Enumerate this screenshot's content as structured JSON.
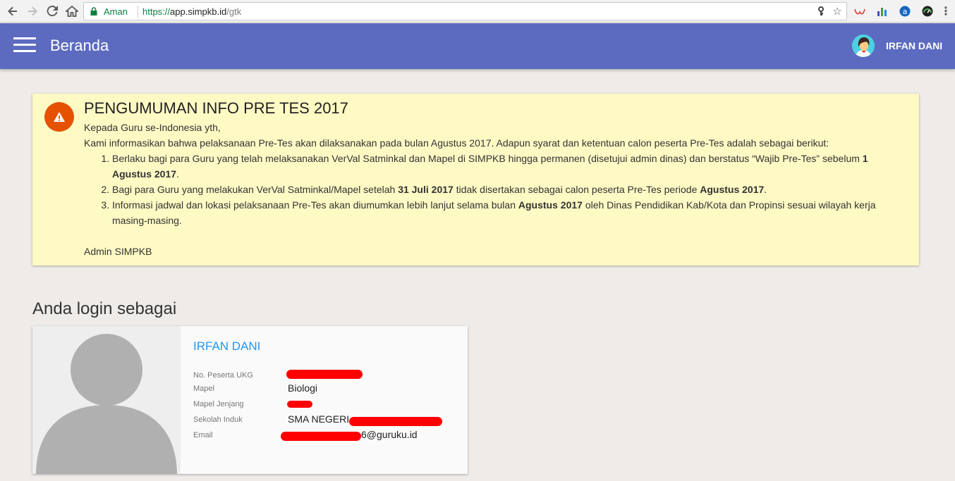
{
  "browser": {
    "secure_label": "Aman",
    "url_scheme": "https://",
    "url_host": "app.simpkb.id",
    "url_path": "/gtk"
  },
  "appbar": {
    "title": "Beranda",
    "user_name": "IRFAN DANI",
    "color": "#5c6bc0"
  },
  "announcement": {
    "title": "PENGUMUMAN INFO PRE TES 2017",
    "greeting": "Kepada Guru se-Indonesia yth,",
    "intro": "Kami informasikan bahwa pelaksanaan Pre-Tes akan dilaksanakan pada bulan Agustus 2017. Adapun syarat dan ketentuan calon peserta Pre-Tes adalah sebagai berikut:",
    "items": [
      {
        "part1": "Berlaku bagi para Guru yang telah melaksanakan VerVal Satminkal dan Mapel di SIMPKB hingga permanen (disetujui admin dinas) dan berstatus “Wajib Pre-Tes” sebelum ",
        "bold1": "1 Agustus 2017",
        "part2": "."
      },
      {
        "part1": "Bagi para Guru yang melakukan VerVal Satminkal/Mapel setelah ",
        "bold1": "31 Juli 2017",
        "part2": " tidak disertakan sebagai calon peserta Pre-Tes periode ",
        "bold2": "Agustus 2017",
        "part3": "."
      },
      {
        "part1": "Informasi jadwal dan lokasi pelaksanaan Pre-Tes akan diumumkan lebih lanjut selama bulan ",
        "bold1": "Agustus 2017",
        "part2": " oleh Dinas Pendidikan Kab/Kota dan Propinsi sesuai wilayah kerja masing-masing."
      }
    ],
    "signature": "Admin SIMPKB",
    "background": "#fff9c4",
    "icon_color": "#e65100"
  },
  "login": {
    "heading": "Anda login sebagai",
    "name": "IRFAN DANI",
    "fields": [
      {
        "label": "No. Peserta UKG",
        "value": ""
      },
      {
        "label": "Mapel",
        "value": "Biologi"
      },
      {
        "label": "Mapel Jenjang",
        "value": ""
      },
      {
        "label": "Sekolah Induk",
        "value": "SMA NEGERI"
      },
      {
        "label": "Email",
        "value": "6@guruku.id"
      }
    ]
  }
}
